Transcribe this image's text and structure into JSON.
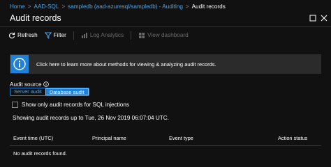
{
  "breadcrumb": {
    "items": [
      "Home",
      "AAD-SQL",
      "sampledb (aad-azuresql/sampledb) - Auditing"
    ],
    "current": "Audit records"
  },
  "blade": {
    "title": "Audit records"
  },
  "toolbar": {
    "refresh": "Refresh",
    "filter": "Filter",
    "log_analytics": "Log Analytics",
    "view_dashboard": "View dashboard"
  },
  "banner": {
    "text": "Click here to learn more about methods for viewing & analyzing audit records."
  },
  "audit_source": {
    "label": "Audit source",
    "options": [
      "Server audit",
      "Database audit"
    ],
    "selected": "Database audit"
  },
  "filter_sql_injection": {
    "label": "Show only audit records for SQL injections",
    "checked": false
  },
  "showing_text": "Showing audit records up to Tue, 26 Nov 2019 06:07:04 UTC.",
  "table": {
    "columns": [
      "Event time (UTC)",
      "Principal name",
      "Event type",
      "Action status"
    ],
    "empty_message": "No audit records found."
  },
  "colors": {
    "background": "#111111",
    "accent": "#1f82d8",
    "link": "#4ea6ea",
    "banner_bg": "#2b2b2b",
    "disabled_text": "#6a6a6a"
  },
  "icons": {
    "refresh": "refresh-icon",
    "filter": "filter-icon",
    "log_analytics": "log-analytics-icon",
    "view_dashboard": "dashboard-icon",
    "info": "info-icon",
    "maximize": "maximize-icon",
    "close": "close-icon"
  }
}
